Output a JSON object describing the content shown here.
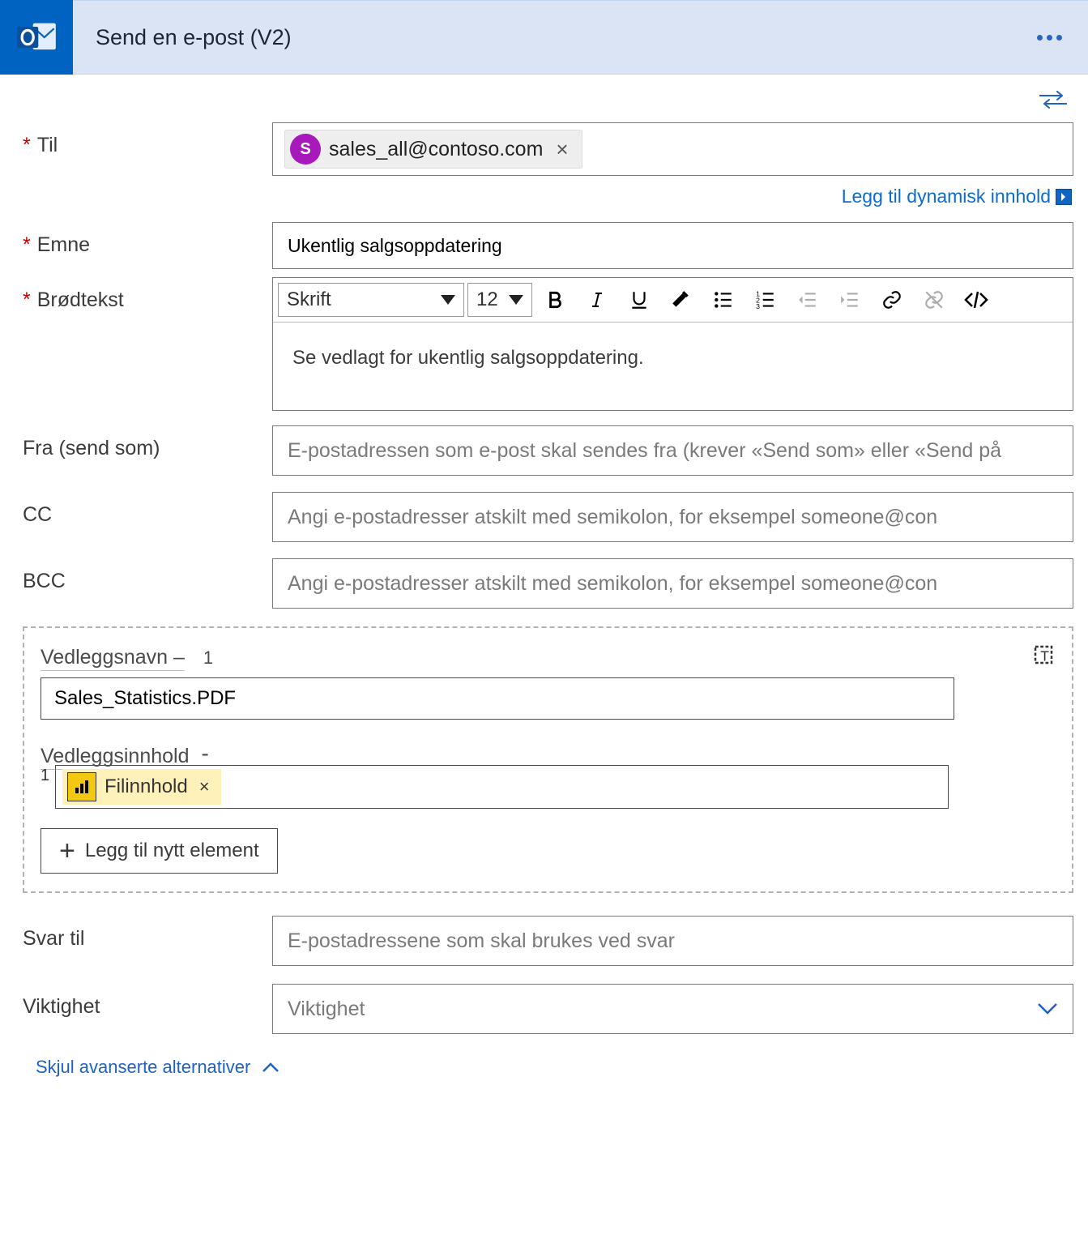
{
  "header": {
    "title": "Send en e-post (V2)"
  },
  "dynamic_link": "Legg til dynamisk innhold",
  "fields": {
    "to_label": "Til",
    "to_chip_initial": "S",
    "to_chip_email": "sales_all@contoso.com",
    "subject_label": "Emne",
    "subject_value": "Ukentlig salgsoppdatering",
    "body_label": "Brødtekst",
    "font_select": "Skrift",
    "size_select": "12",
    "body_text": "Se vedlagt for ukentlig salgsoppdatering.",
    "from_label": "Fra (send som)",
    "from_placeholder": "E-postadressen som e-post skal sendes fra (krever «Send som» eller «Send på",
    "cc_label": "CC",
    "cc_placeholder": "Angi e-postadresser atskilt med semikolon, for eksempel someone@con",
    "bcc_label": "BCC",
    "bcc_placeholder": "Angi e-postadresser atskilt med semikolon, for eksempel someone@con",
    "reply_label": "Svar til",
    "reply_placeholder": "E-postadressene som skal brukes ved svar",
    "importance_label": "Viktighet",
    "importance_placeholder": "Viktighet"
  },
  "attachments": {
    "name_label": "Vedleggsnavn –",
    "name_index": "1",
    "name_value": "Sales_Statistics.PDF",
    "content_label": "Vedleggsinnhold",
    "content_index": "1",
    "token_label": "Filinnhold",
    "add_label": "Legg til nytt element"
  },
  "hide_advanced": "Skjul avanserte alternativer"
}
